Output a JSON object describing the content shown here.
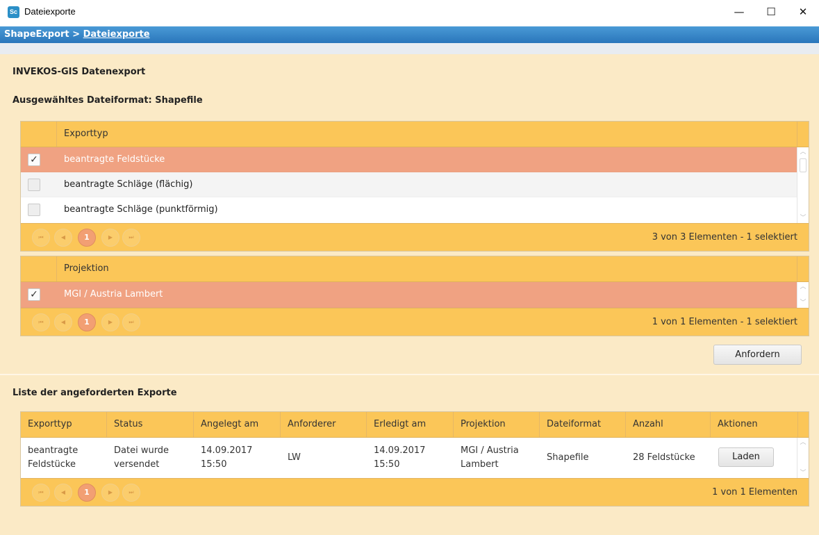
{
  "window": {
    "icon_text": "Sc",
    "title": "Dateiexporte",
    "min_glyph": "—",
    "max_glyph": "☐",
    "close_glyph": "✕"
  },
  "breadcrumb": {
    "root": "ShapeExport",
    "separator": ">",
    "current": "Dateiexporte"
  },
  "page": {
    "title": "INVEKOS-GIS Datenexport",
    "selected_format": "Ausgewähltes Dateiformat: Shapefile",
    "list_title": "Liste der angeforderten Exporte"
  },
  "export_types": {
    "header": "Exporttyp",
    "rows": [
      {
        "label": "beantragte Feldstücke",
        "checked": true
      },
      {
        "label": "beantragte Schläge (flächig)",
        "checked": false
      },
      {
        "label": "beantragte Schläge (punktförmig)",
        "checked": false
      }
    ],
    "pager_page": "1",
    "pager_info": "3 von 3 Elementen - 1 selektiert"
  },
  "projections": {
    "header": "Projektion",
    "rows": [
      {
        "label": "MGI / Austria Lambert",
        "checked": true
      }
    ],
    "pager_page": "1",
    "pager_info": "1 von 1 Elementen - 1 selektiert"
  },
  "request_button": "Anfordern",
  "exports_table": {
    "columns": [
      "Exporttyp",
      "Status",
      "Angelegt am",
      "Anforderer",
      "Erledigt am",
      "Projektion",
      "Dateiformat",
      "Anzahl",
      "Aktionen"
    ],
    "rows": [
      {
        "exporttyp": "beantragte\nFeldstücke",
        "status": "Datei wurde\nversendet",
        "angelegt": "14.09.2017\n15:50",
        "anforderer": "LW",
        "erledigt": "14.09.2017\n15:50",
        "projektion": "MGI / Austria\nLambert",
        "dateiformat": "Shapefile",
        "anzahl": "28 Feldstücke",
        "action": "Laden"
      }
    ],
    "pager_page": "1",
    "pager_info": "1 von 1 Elementen"
  },
  "pager_icons": {
    "first": "⏮",
    "prev": "◀",
    "next": "▶",
    "last": "⏭"
  },
  "colors": {
    "accent_header": "#fbc658",
    "selected_row": "#f0a282",
    "background": "#fbeac6",
    "breadcrumb": "#2a76bb"
  }
}
